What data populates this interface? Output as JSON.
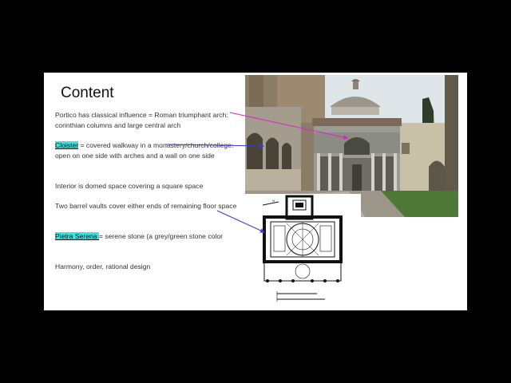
{
  "slide": {
    "title": "Content",
    "para1": "Portico has classical influence = Roman triumphant arch:  corinthian columns and large central arch",
    "para2_term": "Cloister",
    "para2_rest": " = covered walkway in a monastery/church/college:  open on one side with arches and a wall on one side",
    "para3": "Interior is domed space covering a square space",
    "para4": "Two barrel vaults cover either ends of remaining floor space",
    "para5_term": "Pietra Serena ",
    "para5_rest": "= serene stone (a grey/green stone color",
    "para6": "Harmony, order, rational design"
  },
  "colors": {
    "highlight": "#33e5e5",
    "arrow1": "#e020d0",
    "arrow2": "#3a3ad8",
    "arrow3": "#3a3ad8"
  }
}
